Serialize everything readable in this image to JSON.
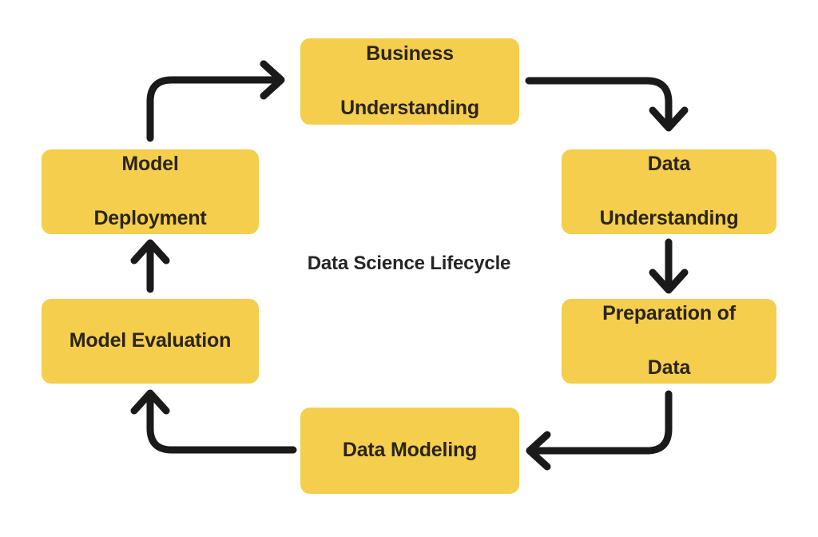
{
  "diagram": {
    "title": "Data Science Lifecycle",
    "background_color": "#ffffff",
    "node_color": "#f5ce4d",
    "node_text_color": "#2b2417",
    "title_color": "#262626",
    "arrow_color": "#1a1a1a",
    "nodes": [
      {
        "id": "business-understanding",
        "line1": "Business",
        "line2": "Understanding"
      },
      {
        "id": "data-understanding",
        "line1": "Data",
        "line2": "Understanding"
      },
      {
        "id": "preparation-of-data",
        "line1": "Preparation of",
        "line2": "Data"
      },
      {
        "id": "data-modeling",
        "line1": "Data Modeling",
        "line2": ""
      },
      {
        "id": "model-evaluation",
        "line1": "Model Evaluation",
        "line2": ""
      },
      {
        "id": "model-deployment",
        "line1": "Model",
        "line2": "Deployment"
      }
    ],
    "arrows": [
      {
        "id": "business-understanding-to-data-understanding",
        "from": "Business Understanding",
        "to": "Data Understanding",
        "shape": "elbow-right-down"
      },
      {
        "id": "data-understanding-to-preparation-of-data",
        "from": "Data Understanding",
        "to": "Preparation of Data",
        "shape": "straight-down"
      },
      {
        "id": "preparation-of-data-to-data-modeling",
        "from": "Preparation of Data",
        "to": "Data Modeling",
        "shape": "elbow-down-left"
      },
      {
        "id": "data-modeling-to-model-evaluation",
        "from": "Data Modeling",
        "to": "Model Evaluation",
        "shape": "elbow-left-up"
      },
      {
        "id": "model-evaluation-to-model-deployment",
        "from": "Model Evaluation",
        "to": "Model Deployment",
        "shape": "straight-up"
      },
      {
        "id": "model-deployment-to-business-understanding",
        "from": "Model Deployment",
        "to": "Business Understanding",
        "shape": "elbow-up-right"
      }
    ]
  }
}
